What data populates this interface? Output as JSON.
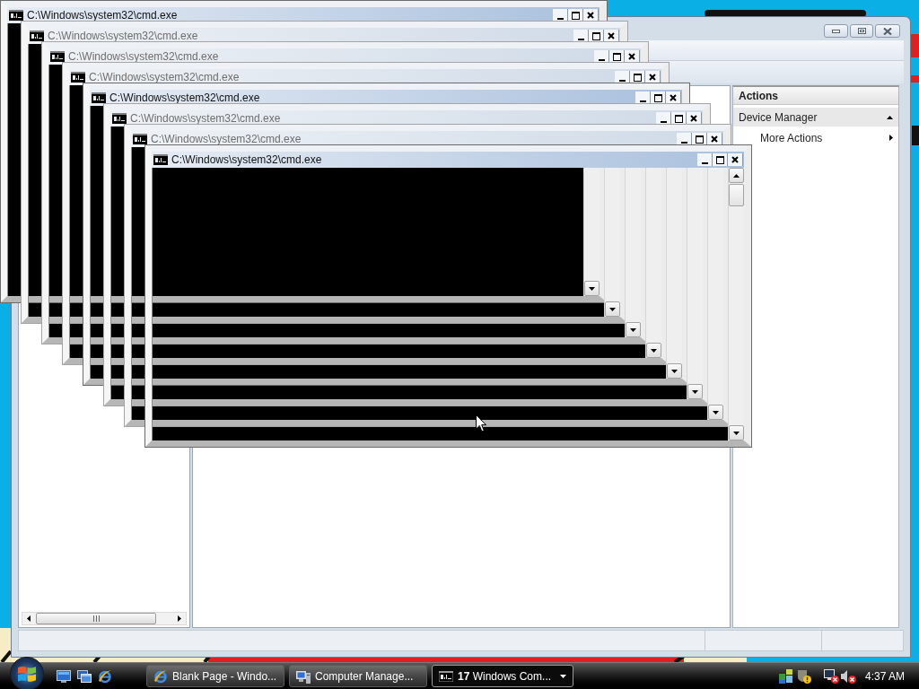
{
  "console_windows": [
    {
      "title": "C:\\Windows\\system32\\cmd.exe",
      "active": true
    },
    {
      "title": "C:\\Windows\\system32\\cmd.exe",
      "active": false
    },
    {
      "title": "C:\\Windows\\system32\\cmd.exe",
      "active": false
    },
    {
      "title": "C:\\Windows\\system32\\cmd.exe",
      "active": false
    },
    {
      "title": "C:\\Windows\\system32\\cmd.exe",
      "active": true
    },
    {
      "title": "C:\\Windows\\system32\\cmd.exe",
      "active": false
    },
    {
      "title": "C:\\Windows\\system32\\cmd.exe",
      "active": false
    },
    {
      "title": "C:\\Windows\\system32\\cmd.exe",
      "active": true
    }
  ],
  "management_window": {
    "actions_pane": {
      "header": "Actions",
      "items": [
        {
          "label": "Device Manager",
          "kind": "section",
          "expanded": true
        },
        {
          "label": "More Actions",
          "kind": "submenu"
        }
      ]
    }
  },
  "taskbar": {
    "tasks": [
      {
        "label": "Blank Page - Windo...",
        "kind": "browser",
        "selected": false
      },
      {
        "label": "Computer Manage...",
        "kind": "management",
        "selected": false
      },
      {
        "label": "**17** Windows Com...",
        "kind": "console_group",
        "selected": true
      }
    ],
    "clock": "4:37 AM"
  }
}
